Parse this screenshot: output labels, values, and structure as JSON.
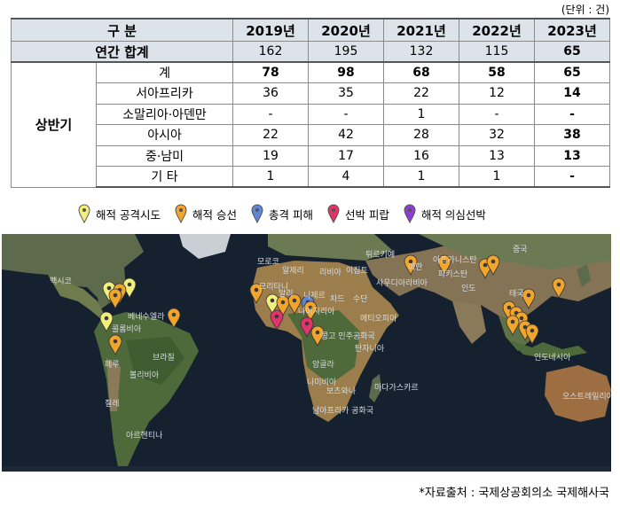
{
  "unit_note": "(단위 : 건)",
  "table": {
    "header": [
      "구 분",
      "2019년",
      "2020년",
      "2021년",
      "2022년",
      "2023년"
    ],
    "annual": {
      "label": "연간 합계",
      "values": [
        "162",
        "195",
        "132",
        "115",
        "65"
      ]
    },
    "group_label": "상반기",
    "rows": [
      {
        "label": "계",
        "values": [
          "78",
          "98",
          "68",
          "58",
          "65"
        ]
      },
      {
        "label": "서아프리카",
        "values": [
          "36",
          "35",
          "22",
          "12",
          "14"
        ]
      },
      {
        "label": "소말리아·아덴만",
        "values": [
          "-",
          "-",
          "1",
          "-",
          "-"
        ]
      },
      {
        "label": "아시아",
        "values": [
          "22",
          "42",
          "28",
          "32",
          "38"
        ]
      },
      {
        "label": "중·남미",
        "values": [
          "19",
          "17",
          "16",
          "13",
          "13"
        ]
      },
      {
        "label": "기 타",
        "values": [
          "1",
          "4",
          "1",
          "1",
          "-"
        ]
      }
    ]
  },
  "legend": [
    {
      "label": "해적 공격시도",
      "color": "#f2ee7a",
      "icon": "yellow-pin-icon"
    },
    {
      "label": "해적 승선",
      "color": "#f2a52b",
      "icon": "orange-pin-icon"
    },
    {
      "label": "총격 피해",
      "color": "#5f86d6",
      "icon": "blue-pin-icon"
    },
    {
      "label": "선박 피랍",
      "color": "#e2336b",
      "icon": "red-pin-icon"
    },
    {
      "label": "해적 의심선박",
      "color": "#8a3fd1",
      "icon": "purple-pin-icon"
    }
  ],
  "map_labels": {
    "mexico": "멕시코",
    "venezuela": "베네수엘라",
    "colombia": "콜롬비아",
    "peru": "페루",
    "brazil": "브라질",
    "bolivia": "볼리비아",
    "chile": "칠레",
    "argentina": "아르헨티나",
    "algeria": "알제리",
    "libya": "리비아",
    "egypt": "이집트",
    "mali": "말리",
    "niger": "니제르",
    "chad": "차드",
    "sudan": "수단",
    "nigeria": "나이지리아",
    "ethiopia": "에티오피아",
    "drc": "콩고 민주공화국",
    "tanzania": "탄자니아",
    "angola": "앙골라",
    "namibia": "나미비아",
    "botswana": "보츠와나",
    "south_africa": "남아프리카 공화국",
    "madagascar": "마다가스카르",
    "saudi": "사우디아라비아",
    "iran": "이란",
    "afghanistan": "아프가니스탄",
    "pakistan": "파키스탄",
    "india": "인도",
    "china": "중국",
    "thailand": "태국",
    "indonesia": "인도네시아",
    "australia": "오스트레일리아",
    "turkey": "튀르키예",
    "morocco": "모로코",
    "mauritania": "모리타니"
  },
  "source": "*자료출처 : 국제상공회의소 국제해사국"
}
